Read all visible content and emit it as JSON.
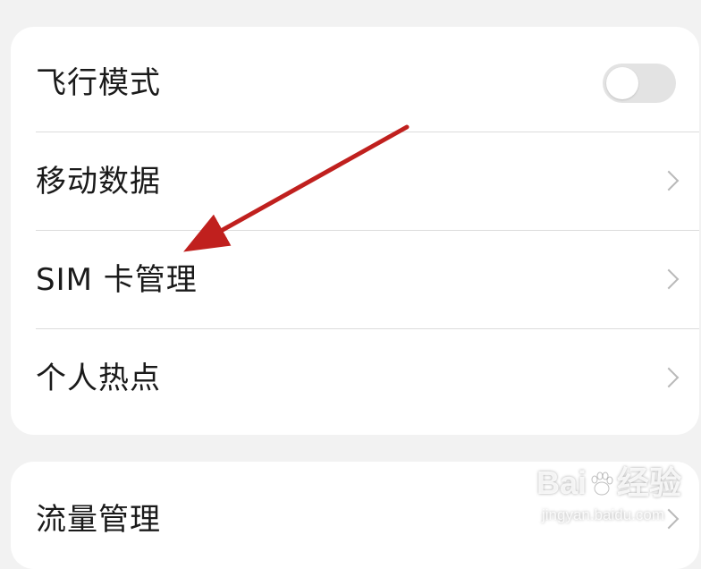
{
  "settings": {
    "items": [
      {
        "label": "飞行模式",
        "control": "toggle",
        "toggle_on": false
      },
      {
        "label": "移动数据",
        "control": "chevron"
      },
      {
        "label": "SIM 卡管理",
        "control": "chevron"
      },
      {
        "label": "个人热点",
        "control": "chevron"
      }
    ],
    "second_group": [
      {
        "label": "流量管理",
        "control": "chevron"
      }
    ]
  },
  "annotation": {
    "arrow_color": "#c0201e",
    "points_to": "SIM 卡管理"
  },
  "watermark": {
    "brand_left": "Bai",
    "brand_right": "经验",
    "site": "jingyan.baidu.com"
  },
  "colors": {
    "background": "#f2f2f2",
    "card": "#ffffff",
    "text": "#1a1a1a",
    "divider": "#dcdcdc",
    "chevron": "#b9b9b9",
    "toggle_track_off": "#e3e3e3"
  }
}
